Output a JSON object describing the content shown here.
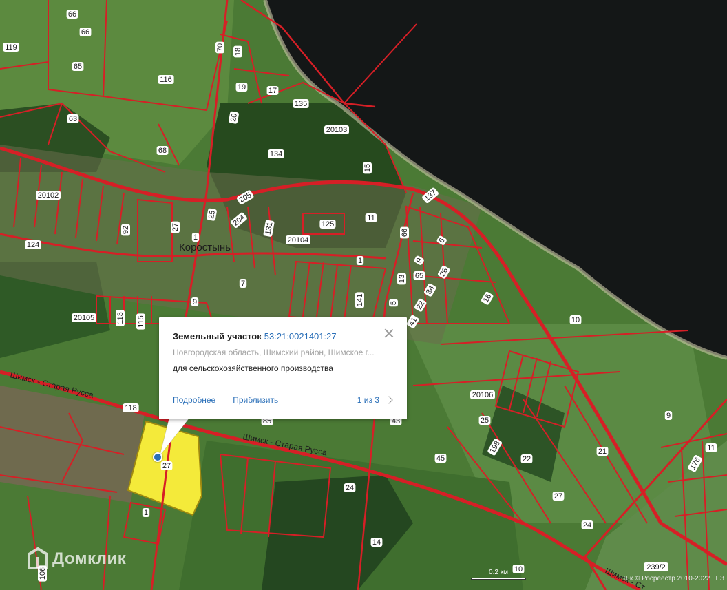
{
  "map": {
    "place_name": "Коростынь",
    "roads": [
      {
        "name": "Шимск - Старая Русса"
      },
      {
        "name": "Шимск - Старая Русса"
      },
      {
        "name": "Шимск - Ст"
      }
    ],
    "plot_labels": [
      "66",
      "66",
      "119",
      "65",
      "116",
      "70",
      "18",
      "19",
      "17",
      "135",
      "63",
      "20",
      "20103",
      "68",
      "134",
      "15",
      "137",
      "20102",
      "205",
      "25",
      "204",
      "125",
      "11",
      "27",
      "1",
      "131",
      "92",
      "124",
      "20104",
      "1",
      "66",
      "6",
      "9",
      "26",
      "65",
      "13",
      "34",
      "5",
      "22",
      "41",
      "16",
      "141",
      "7",
      "9",
      "20105",
      "113",
      "115",
      "10",
      "118",
      "20106",
      "85",
      "43",
      "25",
      "198",
      "45",
      "27",
      "22",
      "21",
      "9",
      "24",
      "27",
      "176",
      "11",
      "1",
      "24",
      "14",
      "24",
      "10",
      "239/2",
      "106"
    ],
    "selected_plot_label": "27",
    "colors": {
      "water": "#141717",
      "field": "#4b7a35",
      "forest": "#264a1e",
      "boundary": "#d61f26",
      "selected": "#f4ea3a"
    }
  },
  "popup": {
    "title": "Земельный участок",
    "cadastral_number": "53:21:0021401:27",
    "address": "Новгородская область, Шимский район, Шимское г...",
    "usage": "для сельскохозяйственного производства",
    "action_details": "Подробнее",
    "action_zoom": "Приблизить",
    "pager": "1 из 3",
    "close_icon": "close-icon",
    "next_icon": "chevron-right-icon"
  },
  "watermark": {
    "text": "Домклик",
    "icon": "house-logo-icon"
  },
  "scale": {
    "label": "0.2 км"
  },
  "attribution": {
    "text": "Шк © Росреестр 2010-2022 | ЕЗ"
  }
}
